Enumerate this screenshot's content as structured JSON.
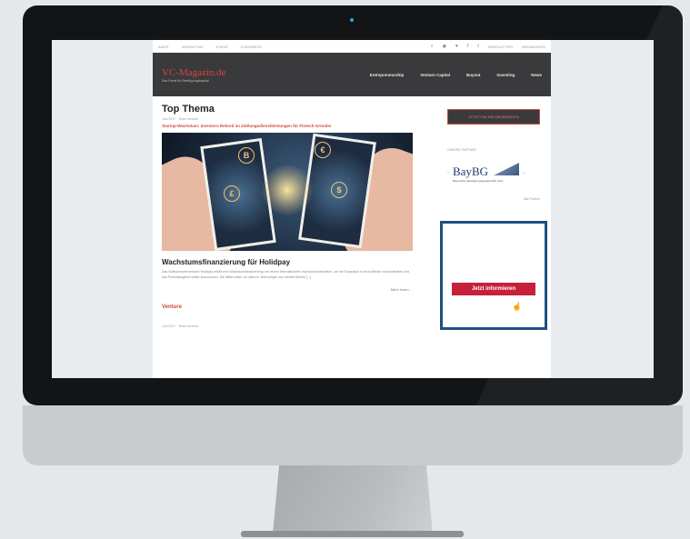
{
  "site": {
    "logo": "VC-Magazin.de",
    "tagline": "Das Portal für Beteiligungskapital"
  },
  "topbar": {
    "links": [
      "AUDIT",
      "MARKETING",
      "EVENT",
      "KONGRESS"
    ],
    "right_links": [
      "NEWSLETTER",
      "MEDIADATEN"
    ],
    "icons": [
      "search-icon",
      "rss-icon",
      "heart-icon",
      "facebook-icon",
      "twitter-icon"
    ]
  },
  "nav": {
    "items": [
      "Entrepreneurship",
      "Venture Capital",
      "Buyout",
      "Investing",
      "News"
    ]
  },
  "main": {
    "section_title": "Top Thema",
    "meta": "Juni 2017 · Team Venture",
    "headline": "Startup-Wachstum: Investors Rekord im Zahlungsdienstleistungen für Fintech-Gründer",
    "article_title": "Wachstumsfinanzierung für Holidpay",
    "excerpt": "Das Softwareunternehmen Holidpay erhält eine Wachstumsfinanzierung von einem internationalen Investorenkonsortium, um die Expansion in neue Märkte voranzutreiben und das Produktangebot weiter auszubauen. Die Mittel sollen vor allem in Technologie und Vertrieb fließen [...]",
    "more_label": "Mehr lesen ...",
    "category": "Venture",
    "meta2": "Juni 2017 · Team Venture"
  },
  "hero": {
    "coins": [
      "B",
      "€",
      "$",
      "£"
    ]
  },
  "sidebar": {
    "button_label": "JETZT ONLINE ABONNIEREN",
    "partner_label": "UNSERE PARTNER",
    "partner_name": "BayBG",
    "partner_sub": "Bayerische Beteiligungsgesellschaft mbH",
    "partner_link": "Alle Partner",
    "ad_cta": "Jetzt informieren"
  },
  "colors": {
    "accent": "#d04a3c",
    "header_bg": "#3a3a3c",
    "ad_border": "#1f4f82",
    "cta": "#c7203a"
  }
}
